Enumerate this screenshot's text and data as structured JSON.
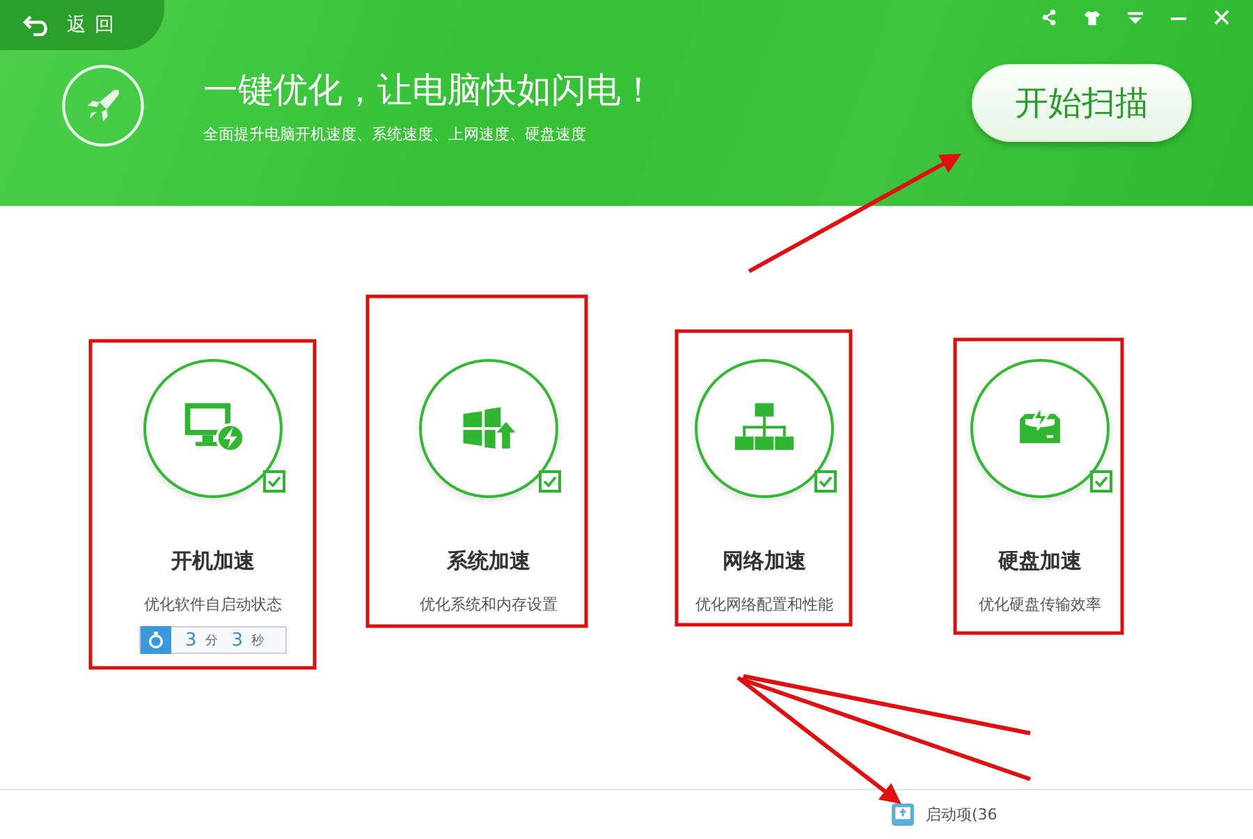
{
  "header": {
    "back_label": "返回",
    "title": "一键优化，让电脑快如闪电！",
    "subtitle": "全面提升电脑开机速度、系统速度、上网速度、硬盘速度",
    "scan_button": "开始扫描"
  },
  "cards": [
    {
      "kind": "monitor",
      "title": "开机加速",
      "description": "优化软件自启动状态",
      "checked": true,
      "timer": {
        "minutes": "3",
        "minutes_unit": "分",
        "seconds": "3",
        "seconds_unit": "秒"
      }
    },
    {
      "kind": "windows",
      "title": "系统加速",
      "description": "优化系统和内存设置",
      "checked": true
    },
    {
      "kind": "network",
      "title": "网络加速",
      "description": "优化网络配置和性能",
      "checked": true
    },
    {
      "kind": "disk",
      "title": "硬盘加速",
      "description": "优化硬盘传输效率",
      "checked": true
    }
  ],
  "status_bar": {
    "startup_items": "启动项(36"
  }
}
